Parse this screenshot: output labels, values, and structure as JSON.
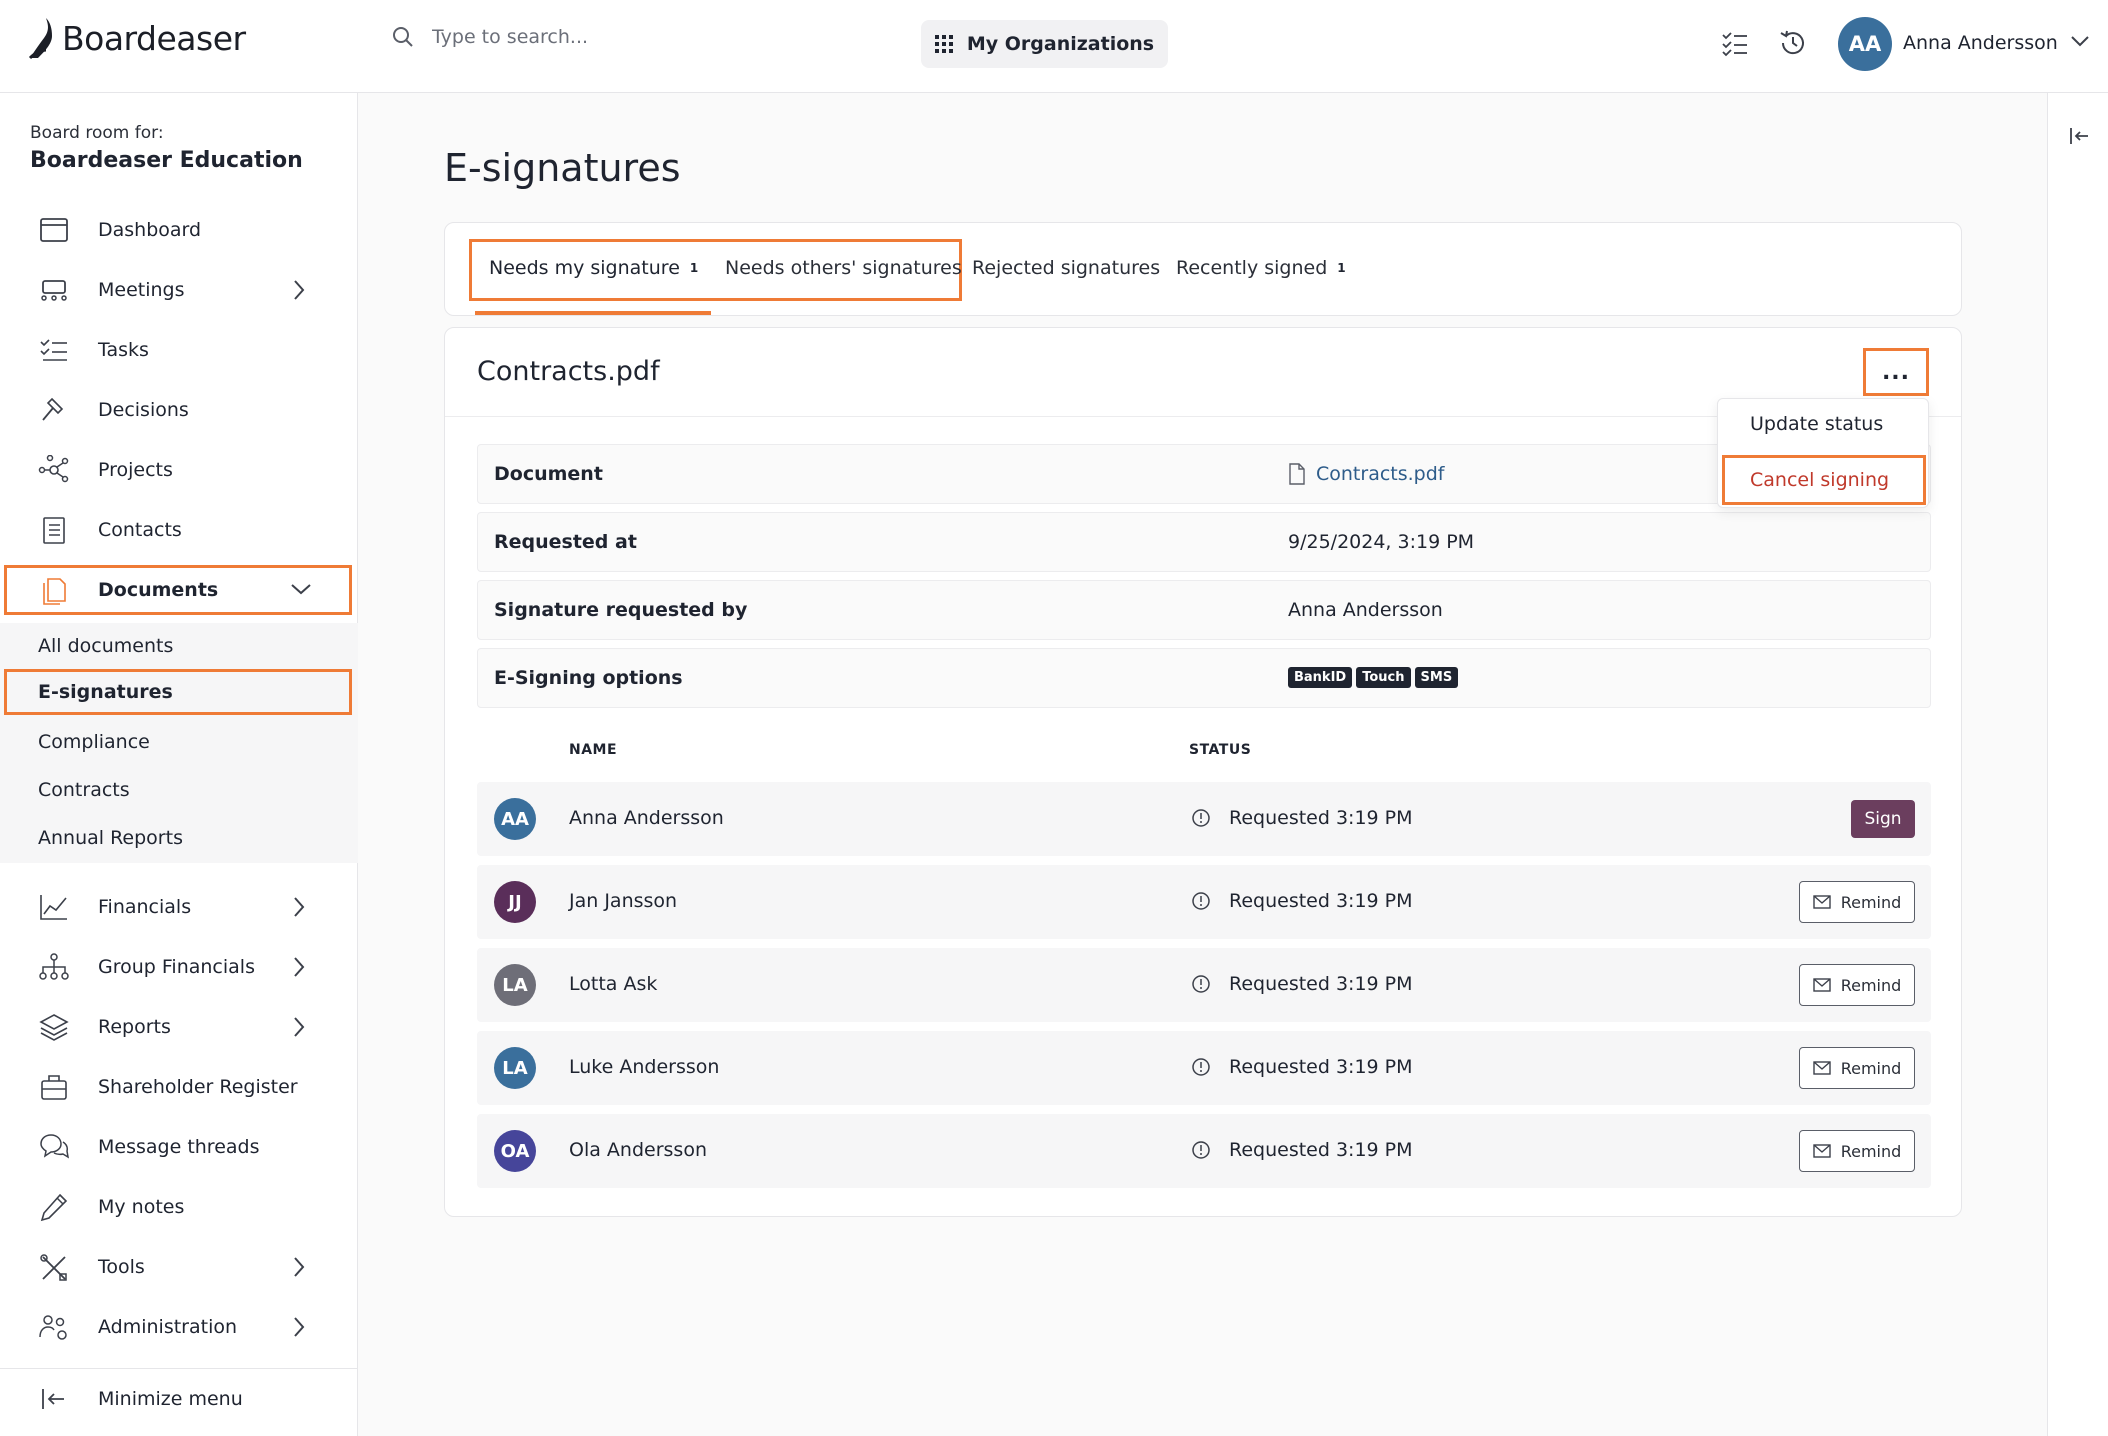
{
  "app": {
    "name": "Boardeaser"
  },
  "header": {
    "search_placeholder": "Type to search...",
    "org_button": "My Organizations",
    "user": {
      "initials": "AA",
      "name": "Anna Andersson"
    }
  },
  "sidebar": {
    "board_for_label": "Board room for:",
    "board_name": "Boardeaser Education",
    "items": [
      {
        "label": "Dashboard"
      },
      {
        "label": "Meetings"
      },
      {
        "label": "Tasks"
      },
      {
        "label": "Decisions"
      },
      {
        "label": "Projects"
      },
      {
        "label": "Contacts"
      },
      {
        "label": "Documents"
      },
      {
        "label": "Financials"
      },
      {
        "label": "Group Financials"
      },
      {
        "label": "Reports"
      },
      {
        "label": "Shareholder Register"
      },
      {
        "label": "Message threads"
      },
      {
        "label": "My notes"
      },
      {
        "label": "Tools"
      },
      {
        "label": "Administration"
      }
    ],
    "documents_sub": [
      {
        "label": "All documents"
      },
      {
        "label": "E-signatures"
      },
      {
        "label": "Compliance"
      },
      {
        "label": "Contracts"
      },
      {
        "label": "Annual Reports"
      }
    ],
    "minimize_label": "Minimize menu"
  },
  "page": {
    "title": "E-signatures",
    "tabs": [
      {
        "label": "Needs my signature",
        "count": "1"
      },
      {
        "label": "Needs others' signatures"
      },
      {
        "label": "Rejected signatures"
      },
      {
        "label": "Recently signed",
        "count": "1"
      }
    ]
  },
  "document": {
    "title": "Contracts.pdf",
    "more_label": "...",
    "menu": {
      "update_status": "Update status",
      "cancel_signing": "Cancel signing"
    },
    "info": {
      "document_label": "Document",
      "document_value": "Contracts.pdf",
      "requested_at_label": "Requested at",
      "requested_at_value": "9/25/2024, 3:19 PM",
      "requested_by_label": "Signature requested by",
      "requested_by_value": "Anna Andersson",
      "options_label": "E-Signing options",
      "options": [
        "BankID",
        "Touch",
        "SMS"
      ]
    },
    "table": {
      "col_name": "NAME",
      "col_status": "STATUS",
      "rows": [
        {
          "initials": "AA",
          "name": "Anna Andersson",
          "status": "Requested 3:19 PM",
          "action": "Sign",
          "color": "#3a6f9c"
        },
        {
          "initials": "JJ",
          "name": "Jan Jansson",
          "status": "Requested 3:19 PM",
          "action": "Remind",
          "color": "#5a2e5a"
        },
        {
          "initials": "LA",
          "name": "Lotta Ask",
          "status": "Requested 3:19 PM",
          "action": "Remind",
          "color": "#6e6e78"
        },
        {
          "initials": "LA",
          "name": "Luke Andersson",
          "status": "Requested 3:19 PM",
          "action": "Remind",
          "color": "#3a6f9c"
        },
        {
          "initials": "OA",
          "name": "Ola Andersson",
          "status": "Requested 3:19 PM",
          "action": "Remind",
          "color": "#46459a"
        }
      ]
    }
  },
  "colors": {
    "accent_highlight": "#ef7b36",
    "sign_button": "#6b3e5e",
    "danger": "#c0392b",
    "link": "#2e5c8a"
  }
}
